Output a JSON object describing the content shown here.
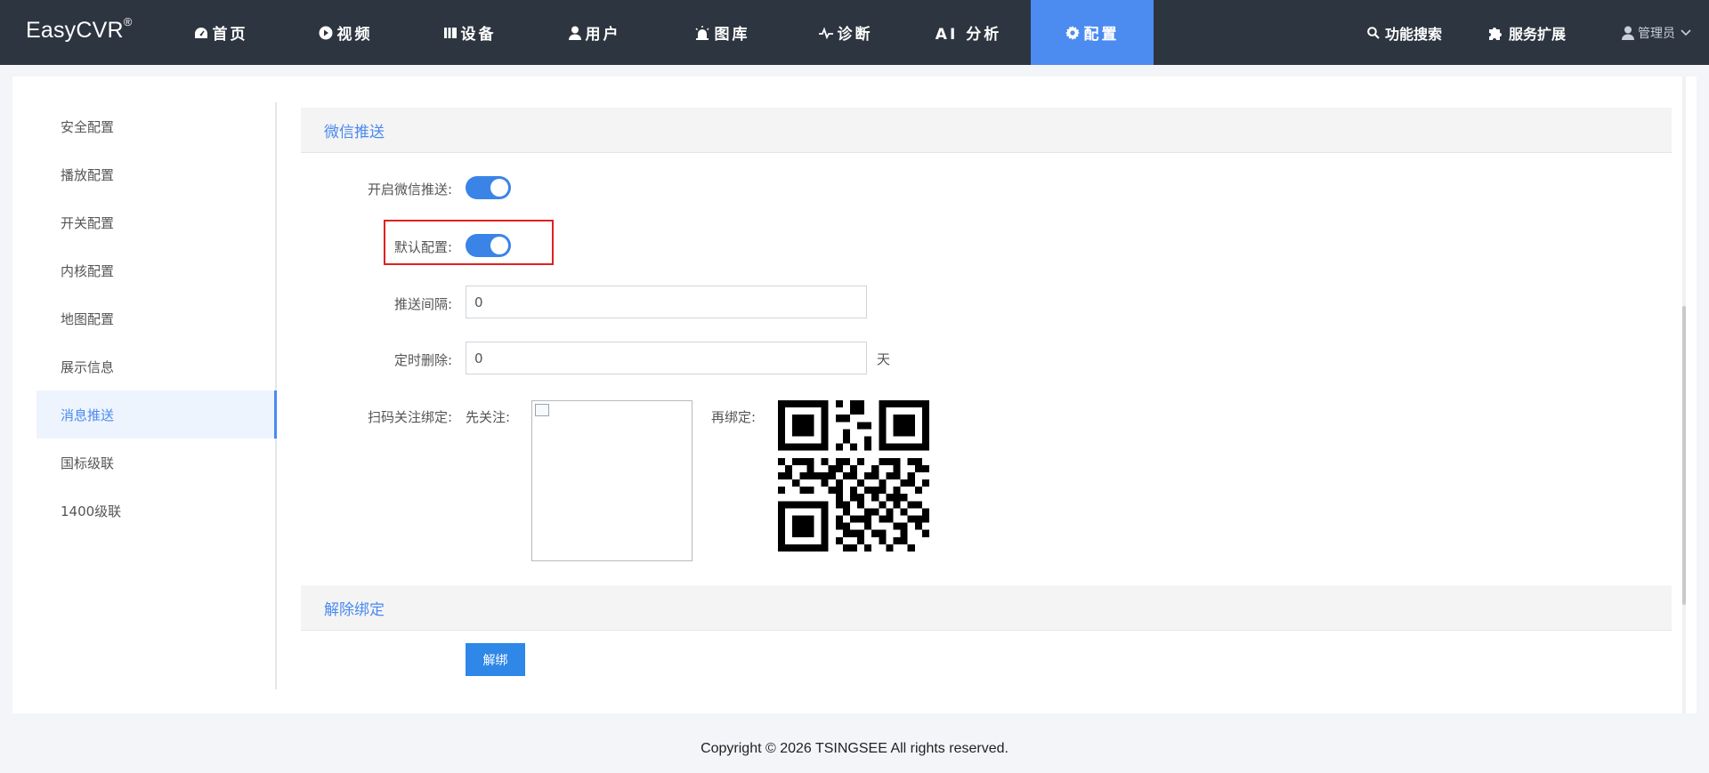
{
  "brand": {
    "name": "EasyCVR",
    "mark": "®"
  },
  "nav": {
    "items": [
      {
        "label": "首页",
        "icon": "dashboard-icon"
      },
      {
        "label": "视频",
        "icon": "play-icon"
      },
      {
        "label": "设备",
        "icon": "device-icon"
      },
      {
        "label": "用户",
        "icon": "user-icon"
      },
      {
        "label": "图库",
        "icon": "alarm-light-icon"
      },
      {
        "label": "诊断",
        "icon": "pulse-icon"
      },
      {
        "label": "AI 分析",
        "icon": ""
      },
      {
        "label": "配置",
        "icon": "gear-icon",
        "active": true
      }
    ],
    "search_label": "功能搜索",
    "extension_label": "服务扩展",
    "user_label": "管理员"
  },
  "sidebar": {
    "items": [
      {
        "label": "安全配置"
      },
      {
        "label": "播放配置"
      },
      {
        "label": "开关配置"
      },
      {
        "label": "内核配置"
      },
      {
        "label": "地图配置"
      },
      {
        "label": "展示信息"
      },
      {
        "label": "消息推送",
        "active": true
      },
      {
        "label": "国标级联"
      },
      {
        "label": "1400级联"
      }
    ]
  },
  "wechat": {
    "section_title": "微信推送",
    "enable_label": "开启微信推送:",
    "enable_on": true,
    "default_label": "默认配置:",
    "default_on": true,
    "interval_label": "推送间隔:",
    "interval_value": "0",
    "delete_label": "定时删除:",
    "delete_value": "0",
    "delete_unit": "天",
    "scan_label": "扫码关注绑定:",
    "follow_label": "先关注:",
    "bind_label": "再绑定:"
  },
  "unbind": {
    "section_title": "解除绑定",
    "button_label": "解绑"
  },
  "footer": {
    "copyright": "Copyright © 2026 TSINGSEE All rights reserved."
  },
  "colors": {
    "nav_bg": "#2d3540",
    "accent": "#4a8af0",
    "highlight": "#e0201f"
  }
}
